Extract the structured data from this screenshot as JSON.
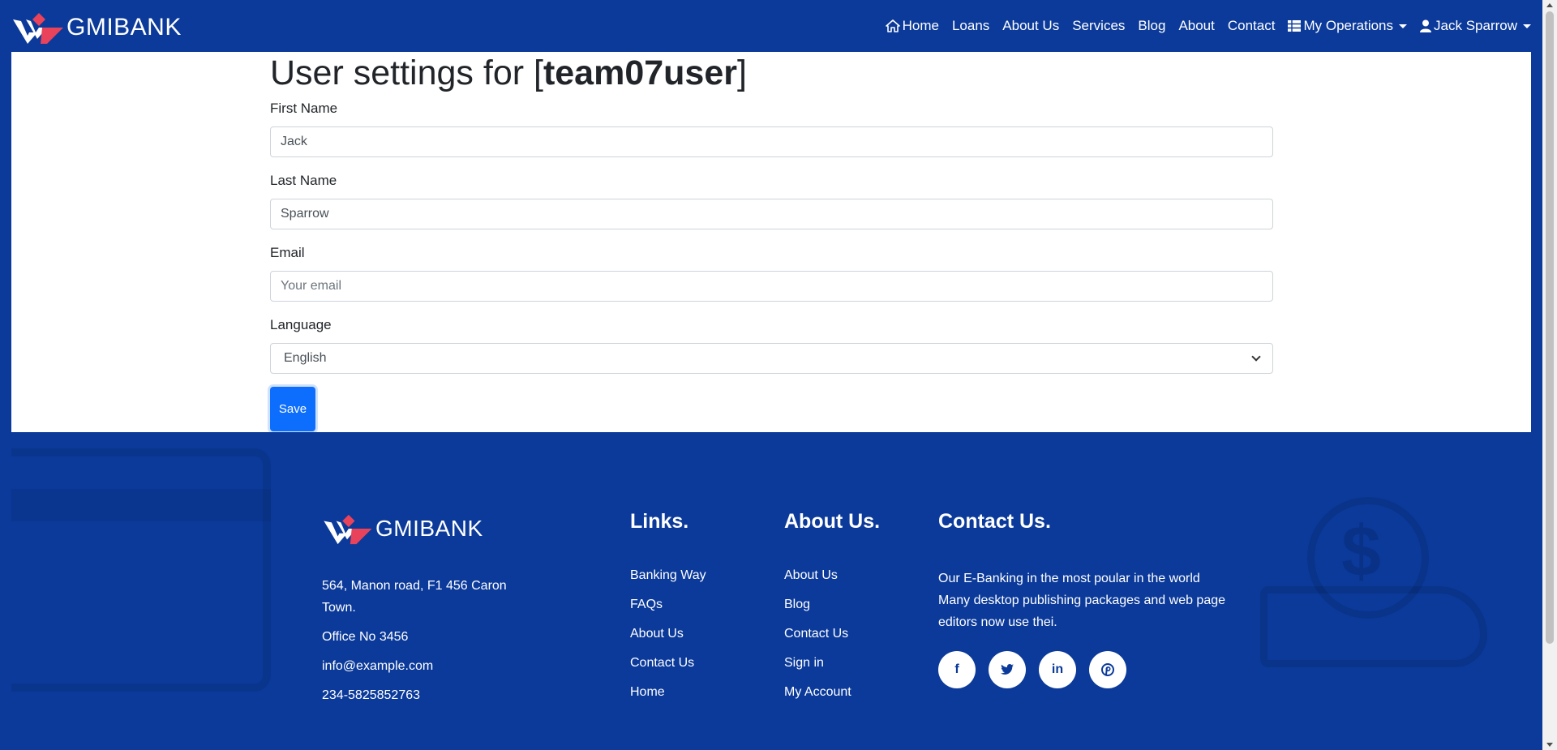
{
  "header": {
    "brand": "GMIBANK",
    "nav": {
      "home": "Home",
      "loans": "Loans",
      "about_us": "About Us",
      "services": "Services",
      "blog": "Blog",
      "about": "About",
      "contact": "Contact",
      "my_operations": "My Operations",
      "user": "Jack Sparrow"
    }
  },
  "settings": {
    "title_prefix": "User settings for [",
    "username": "team07user",
    "title_suffix": "]",
    "first_name_label": "First Name",
    "first_name_value": "Jack",
    "last_name_label": "Last Name",
    "last_name_value": "Sparrow",
    "email_label": "Email",
    "email_placeholder": "Your email",
    "language_label": "Language",
    "language_value": "English",
    "save_label": "Save"
  },
  "footer": {
    "brand": "GMIBANK",
    "address_line": "564, Manon road, F1 456 Caron Town.",
    "office": "Office No 3456",
    "email": "info@example.com",
    "phone": "234-5825852763",
    "links_heading": "Links.",
    "links": [
      "Banking Way",
      "FAQs",
      "About Us",
      "Contact Us",
      "Home"
    ],
    "about_heading": "About Us.",
    "about_links": [
      "About Us",
      "Blog",
      "Contact Us",
      "Sign in",
      "My Account"
    ],
    "contact_heading": "Contact Us.",
    "contact_text": "Our E-Banking in the most poular in the world Many desktop publishing packages and web page editors now use thei.",
    "socials": [
      "f",
      "t",
      "in",
      "p"
    ]
  },
  "colors": {
    "brand_blue": "#0b3a9a",
    "accent_red": "#e8435a",
    "button_blue": "#0d6efd"
  }
}
